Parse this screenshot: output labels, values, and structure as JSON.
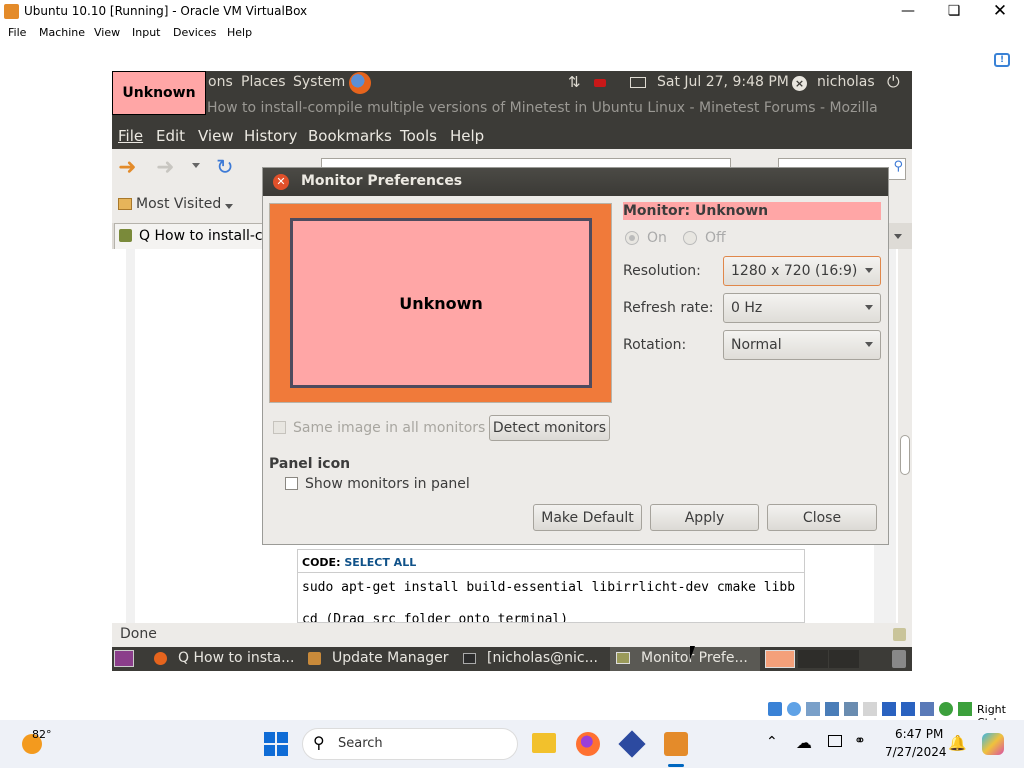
{
  "host": {
    "title": "Ubuntu 10.10 [Running] - Oracle VM VirtualBox",
    "menu": [
      "File",
      "Machine",
      "View",
      "Input",
      "Devices",
      "Help"
    ],
    "status_host_key": "Right Ctrl"
  },
  "guest_top_panel": {
    "badge": "Unknown",
    "menus": [
      "ons",
      "Places",
      "System"
    ],
    "clock": "Sat Jul 27,  9:48 PM",
    "user": "nicholas"
  },
  "firefox": {
    "title": "How to install-compile multiple versions of Minetest in Ubuntu Linux - Minetest Forums - Mozilla",
    "menu": [
      "File",
      "Edit",
      "View",
      "History",
      "Bookmarks",
      "Tools",
      "Help"
    ],
    "bookmarks_label": "Most Visited",
    "tab_label": "Q How to install-co",
    "code_header": "CODE:",
    "code_select_all": "SELECT ALL",
    "code_line1": "sudo apt-get install build-essential libirrlicht-dev cmake libb",
    "code_line2": "cd (Drag src folder onto terminal)",
    "status": "Done"
  },
  "dialog": {
    "title": "Monitor Preferences",
    "preview_label": "Unknown",
    "monitor_header": "Monitor: Unknown",
    "on_label": "On",
    "off_label": "Off",
    "resolution_label": "Resolution:",
    "resolution_value": "1280 x 720 (16:9)",
    "refresh_label": "Refresh rate:",
    "refresh_value": "0 Hz",
    "rotation_label": "Rotation:",
    "rotation_value": "Normal",
    "same_image_label": "Same image in all monitors",
    "detect_button": "Detect monitors",
    "panel_icon_header": "Panel icon",
    "show_monitors_label": "Show monitors in panel",
    "make_default_button": "Make Default",
    "apply_button": "Apply",
    "close_button": "Close"
  },
  "guest_bottom_panel": {
    "tasks": [
      "Q How to insta...",
      "Update Manager",
      "[nicholas@nic...",
      "Monitor Prefe..."
    ]
  },
  "taskbar": {
    "weather": "82°",
    "search_placeholder": "Search",
    "time": "6:47 PM",
    "date": "7/27/2024"
  },
  "colors": {
    "ubuntu_panel": "#3c3b37",
    "monitor_pink": "#ffa6a6",
    "monitor_orange": "#f07a3a",
    "win_accent": "#0067c0"
  }
}
